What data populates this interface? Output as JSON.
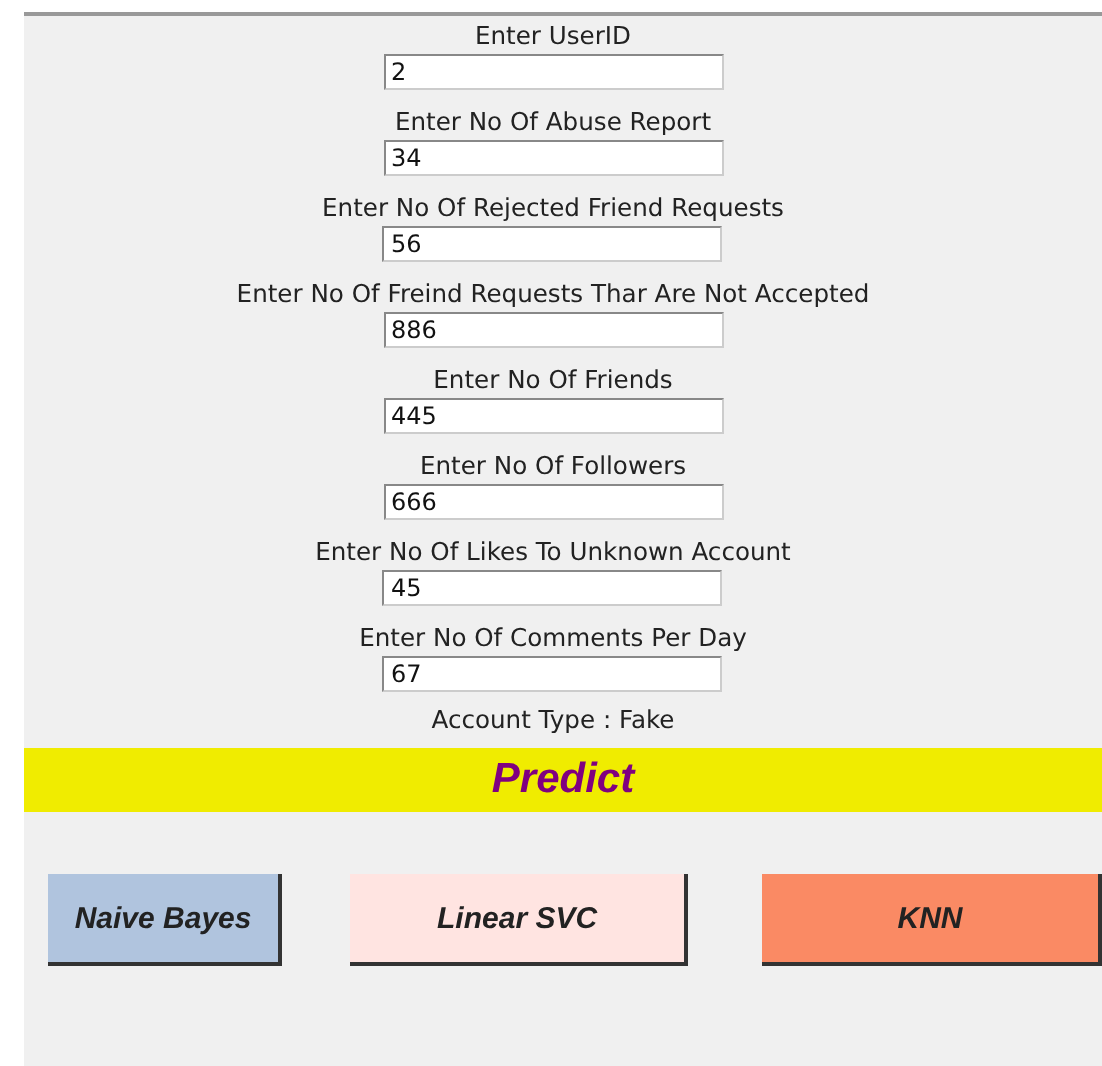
{
  "fields": [
    {
      "prompt": "Enter UserID",
      "value": "2"
    },
    {
      "prompt": "Enter No Of Abuse Report",
      "value": "34"
    },
    {
      "prompt": "Enter No Of Rejected Friend Requests",
      "value": "56"
    },
    {
      "prompt": "Enter No Of Freind Requests Thar Are Not Accepted",
      "value": "886"
    },
    {
      "prompt": "Enter No Of Friends",
      "value": "445"
    },
    {
      "prompt": "Enter No Of Followers",
      "value": "666"
    },
    {
      "prompt": "Enter No Of Likes To Unknown Account",
      "value": "45"
    },
    {
      "prompt": "Enter No Of Comments Per Day",
      "value": "67"
    }
  ],
  "result": "Account Type : Fake",
  "banner": "Predict",
  "buttons": [
    {
      "label": "Naive Bayes",
      "color": "#b0c4de"
    },
    {
      "label": "Linear SVC",
      "color": "#ffe4e1"
    },
    {
      "label": "KNN",
      "color": "#fa8a64"
    }
  ]
}
